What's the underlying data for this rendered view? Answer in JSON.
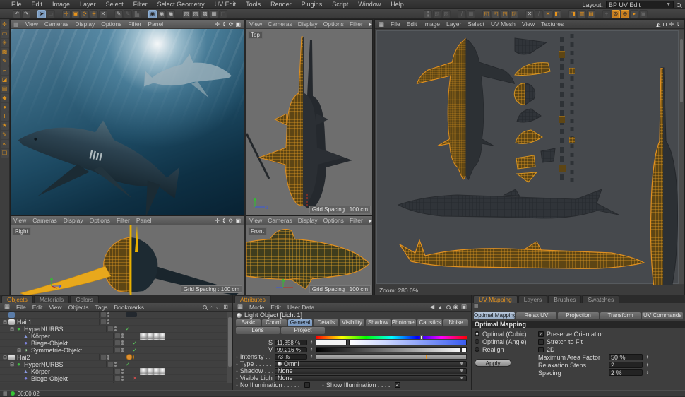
{
  "app": {
    "layout_label": "Layout:",
    "layout_value": "BP UV Edit",
    "time": "00:00:02"
  },
  "menubar": {
    "items": [
      "File",
      "Edit",
      "Image",
      "Layer",
      "Select",
      "Filter",
      "Select Geometry",
      "UV Edit",
      "Tools",
      "Render",
      "Plugins",
      "Script",
      "Window",
      "Help"
    ]
  },
  "toolbar": {
    "left_icons": [
      {
        "g": "↶",
        "n": "undo-icon",
        "s": "n"
      },
      {
        "g": "↷",
        "n": "redo-icon",
        "s": "n"
      },
      {
        "g": "➤",
        "n": "live-selection-icon",
        "s": "b"
      },
      {
        "g": "▭",
        "n": "rectangle-selection-icon",
        "s": "d"
      },
      {
        "g": "✛",
        "n": "move-tool-icon",
        "s": "o"
      },
      {
        "g": "▣",
        "n": "scale-tool-icon",
        "s": "o"
      },
      {
        "g": "⟳",
        "n": "rotate-tool-icon",
        "s": "o"
      },
      {
        "g": "✳",
        "n": "axis-lock-icon",
        "s": "o"
      },
      {
        "g": "✕",
        "n": "coord-system-icon",
        "s": "n"
      },
      {
        "g": "✎",
        "n": "paint-3d-icon",
        "s": "n"
      },
      {
        "g": "✎",
        "n": "paint-disabled-icon",
        "s": "d"
      },
      {
        "g": "▙",
        "n": "workplane-icon",
        "s": "d"
      },
      {
        "g": "◉",
        "n": "texture-paint-icon",
        "s": "b"
      },
      {
        "g": "◉",
        "n": "texture-wizard-icon",
        "s": "n"
      },
      {
        "g": "◉",
        "n": "texture-light-icon",
        "s": "n"
      },
      {
        "g": "▧",
        "n": "cube-top-icon",
        "s": "n"
      },
      {
        "g": "▨",
        "n": "cube-front-icon",
        "s": "n"
      },
      {
        "g": "▩",
        "n": "cube-side-icon",
        "s": "n"
      },
      {
        "g": "▦",
        "n": "cube-uv-icon",
        "s": "n"
      },
      {
        "g": "▢",
        "n": "cube-disabled-icon",
        "s": "d"
      }
    ],
    "right_icons": [
      {
        "g": "¦",
        "n": "uv-pin-icon",
        "s": "n"
      },
      {
        "g": "▨",
        "n": "uv-edit-disabled-icon",
        "s": "d"
      },
      {
        "g": "▧",
        "n": "uv-snap-disabled-icon",
        "s": "d"
      },
      {
        "g": "/",
        "n": "uv-mirror-disabled-icon",
        "s": "d"
      },
      {
        "g": "▦",
        "n": "uv-grid-disabled-icon",
        "s": "d"
      },
      {
        "g": "◱",
        "n": "uv-points-mode-icon",
        "s": "o"
      },
      {
        "g": "◰",
        "n": "uv-edges-mode-icon",
        "s": "o"
      },
      {
        "g": "◳",
        "n": "uv-polys-mode-icon",
        "s": "o"
      },
      {
        "g": "◲",
        "n": "uv-island-mode-icon",
        "s": "o"
      },
      {
        "g": "✕",
        "n": "uv-max-icon",
        "s": "n"
      },
      {
        "g": "/",
        "n": "uv-slash-disabled-icon",
        "s": "d"
      },
      {
        "g": "✕",
        "n": "uv-fit-icon",
        "s": "o"
      },
      {
        "g": "◧",
        "n": "uv-align-left-icon",
        "s": "o"
      },
      {
        "g": "◨",
        "n": "uv-align-right-icon",
        "s": "o"
      },
      {
        "g": "▥",
        "n": "uv-grid-dense-icon",
        "s": "o"
      },
      {
        "g": "▤",
        "n": "uv-grid-rows-icon",
        "s": "o"
      },
      {
        "g": "+",
        "n": "uv-relax-disabled-icon",
        "s": "d"
      },
      {
        "g": "⊛",
        "n": "uv-sphere-mapping-icon",
        "s": "oh"
      },
      {
        "g": "⊛",
        "n": "uv-optimal-mapping-icon",
        "s": "oh"
      },
      {
        "g": "▸",
        "n": "uv-flag-icon",
        "s": "o"
      },
      {
        "g": "▣",
        "n": "uv-copy-disabled-icon",
        "s": "d"
      }
    ]
  },
  "side_toolbar": {
    "icons": [
      {
        "g": "✛",
        "n": "bp-move-icon"
      },
      {
        "g": "▭",
        "n": "bp-select-icon"
      },
      {
        "g": "✳",
        "n": "bp-magic-wand-icon"
      },
      {
        "g": "▩",
        "n": "bp-pattern-icon"
      },
      {
        "g": "✎",
        "n": "bp-brush-icon"
      },
      {
        "g": "⌐",
        "n": "bp-stamp-icon"
      },
      {
        "g": "◪",
        "n": "bp-eraser-icon"
      },
      {
        "g": "▤",
        "n": "bp-gradient-icon"
      },
      {
        "g": "◆",
        "n": "bp-fill-icon"
      },
      {
        "g": "●",
        "n": "bp-dot-icon"
      },
      {
        "g": "T",
        "n": "bp-text-icon"
      },
      {
        "g": "★",
        "n": "bp-star-icon"
      },
      {
        "g": "✎",
        "n": "bp-eyedropper-icon"
      },
      {
        "g": "∞",
        "n": "bp-chain-icon"
      },
      {
        "g": "❏",
        "n": "bp-clone-icon"
      }
    ]
  },
  "viewports": {
    "menu_full": [
      "View",
      "Cameras",
      "Display",
      "Options",
      "Filter",
      "Panel"
    ],
    "menu_short": [
      "View",
      "Cameras",
      "Display",
      "Options",
      "Filter"
    ],
    "top": {
      "label": "Top",
      "grid": "Grid Spacing : 100 cm"
    },
    "right": {
      "label": "Right",
      "grid": "Grid Spacing : 100 cm"
    },
    "front": {
      "label": "Front",
      "grid": "Grid Spacing : 100 cm"
    }
  },
  "uv_editor": {
    "menu": [
      "File",
      "Edit",
      "Image",
      "Layer",
      "Select",
      "UV Mesh",
      "View",
      "Textures"
    ],
    "zoom": "Zoom: 280.0%"
  },
  "objects_panel": {
    "tabs": [
      "Objects",
      "Materials",
      "Colors"
    ],
    "menu": [
      "File",
      "Edit",
      "View",
      "Objects",
      "Tags",
      "Bookmarks"
    ],
    "rows": [
      {
        "label": "",
        "ind": "i0",
        "exp": "en",
        "icon": "ic-part",
        "chk": "ck-n",
        "tags": "tg-dark"
      },
      {
        "label": "Hai 1",
        "ind": "i0",
        "exp": "em",
        "icon": "ic-hai",
        "chk": "ck-n",
        "tags": "tg-n"
      },
      {
        "label": "HyperNURBS",
        "ind": "i1",
        "exp": "em",
        "icon": "ic-hn",
        "chk": "ck-c",
        "tags": "tg-n"
      },
      {
        "label": "Körper",
        "ind": "i2",
        "exp": "en",
        "icon": "ic-cone",
        "chk": "ck-n",
        "tags": "tg-mat"
      },
      {
        "label": "Biege-Objekt",
        "ind": "i2",
        "exp": "en",
        "icon": "ic-bend",
        "chk": "ck-c",
        "tags": "tg-n"
      },
      {
        "label": "Symmetrie-Objekt",
        "ind": "i2",
        "exp": "ep",
        "icon": "ic-sym",
        "chk": "ck-c",
        "tags": "tg-n"
      },
      {
        "label": "Hai2",
        "ind": "i0",
        "exp": "em",
        "icon": "ic-hai",
        "chk": "ck-n",
        "tags": "tg-crawl"
      },
      {
        "label": "HyperNURBS",
        "ind": "i1",
        "exp": "em",
        "icon": "ic-hn",
        "chk": "ck-c",
        "tags": "tg-n"
      },
      {
        "label": "Körper",
        "ind": "i2",
        "exp": "en",
        "icon": "ic-cone",
        "chk": "ck-n",
        "tags": "tg-mat"
      },
      {
        "label": "Biege-Objekt",
        "ind": "i2",
        "exp": "en",
        "icon": "ic-bend",
        "chk": "ck-x",
        "tags": "tg-n"
      },
      {
        "label": "Symmetrie-Objekt",
        "ind": "i2",
        "exp": "ep",
        "icon": "ic-sym",
        "chk": "ck-c",
        "tags": "tg-n"
      }
    ]
  },
  "attributes_panel": {
    "tab": "Attributes",
    "menu": [
      "Mode",
      "Edit",
      "User Data"
    ],
    "title": "Light Object [Licht 1]",
    "tabs1": [
      {
        "label": "Basic",
        "s": ""
      },
      {
        "label": "Coord.",
        "s": ""
      },
      {
        "label": "General",
        "s": "sel"
      },
      {
        "label": "Details",
        "s": ""
      },
      {
        "label": "Visibility",
        "s": ""
      },
      {
        "label": "Shadow",
        "s": ""
      },
      {
        "label": "Photometric",
        "s": ""
      },
      {
        "label": "Caustics",
        "s": ""
      },
      {
        "label": "Noise",
        "s": ""
      }
    ],
    "tabs2": [
      {
        "label": "Lens",
        "s": ""
      },
      {
        "label": "Project",
        "s": ""
      }
    ],
    "s_label": "S",
    "s_value": "11.858 %",
    "v_label": "V",
    "v_value": "99.216 %",
    "intensity_label": "Intensity . . .",
    "intensity_value": "73 %",
    "type_label": "Type . . . . . .",
    "type_value": "Omni",
    "shadow_label": "Shadow . . .",
    "shadow_value": "None",
    "visible_label": "Visible Light",
    "visible_value": "None",
    "noillum_label": "No Illumination . . . . .",
    "showillum_label": "Show Illumination . . . .",
    "showillum_check": "✓"
  },
  "uv_mapping_panel": {
    "tabs": [
      {
        "label": "UV Mapping",
        "s": "on"
      },
      {
        "label": "Layers",
        "s": ""
      },
      {
        "label": "Brushes",
        "s": ""
      },
      {
        "label": "Swatches",
        "s": ""
      }
    ],
    "subtabs": [
      {
        "label": "Optimal Mapping",
        "s": "sel"
      },
      {
        "label": "Relax UV",
        "s": ""
      },
      {
        "label": "Projection",
        "s": ""
      },
      {
        "label": "Transform",
        "s": ""
      },
      {
        "label": "UV Commands",
        "s": ""
      }
    ],
    "section": "Optimal Mapping",
    "radios": [
      {
        "label": "Optimal (Cubic)",
        "s": "on"
      },
      {
        "label": "Optimal (Angle)",
        "s": ""
      },
      {
        "label": "Realign",
        "s": ""
      }
    ],
    "checks": [
      {
        "label": "Preserve Orientation",
        "s": "on",
        "g": "✓"
      },
      {
        "label": "Stretch to Fit",
        "s": "",
        "g": ""
      },
      {
        "label": "2D",
        "s": "",
        "g": ""
      }
    ],
    "fields": [
      {
        "label": "Maximum Area Factor",
        "value": "50 %"
      },
      {
        "label": "Relaxation Steps",
        "value": "2"
      },
      {
        "label": "Spacing",
        "value": "2 %"
      }
    ],
    "apply": "Apply"
  }
}
